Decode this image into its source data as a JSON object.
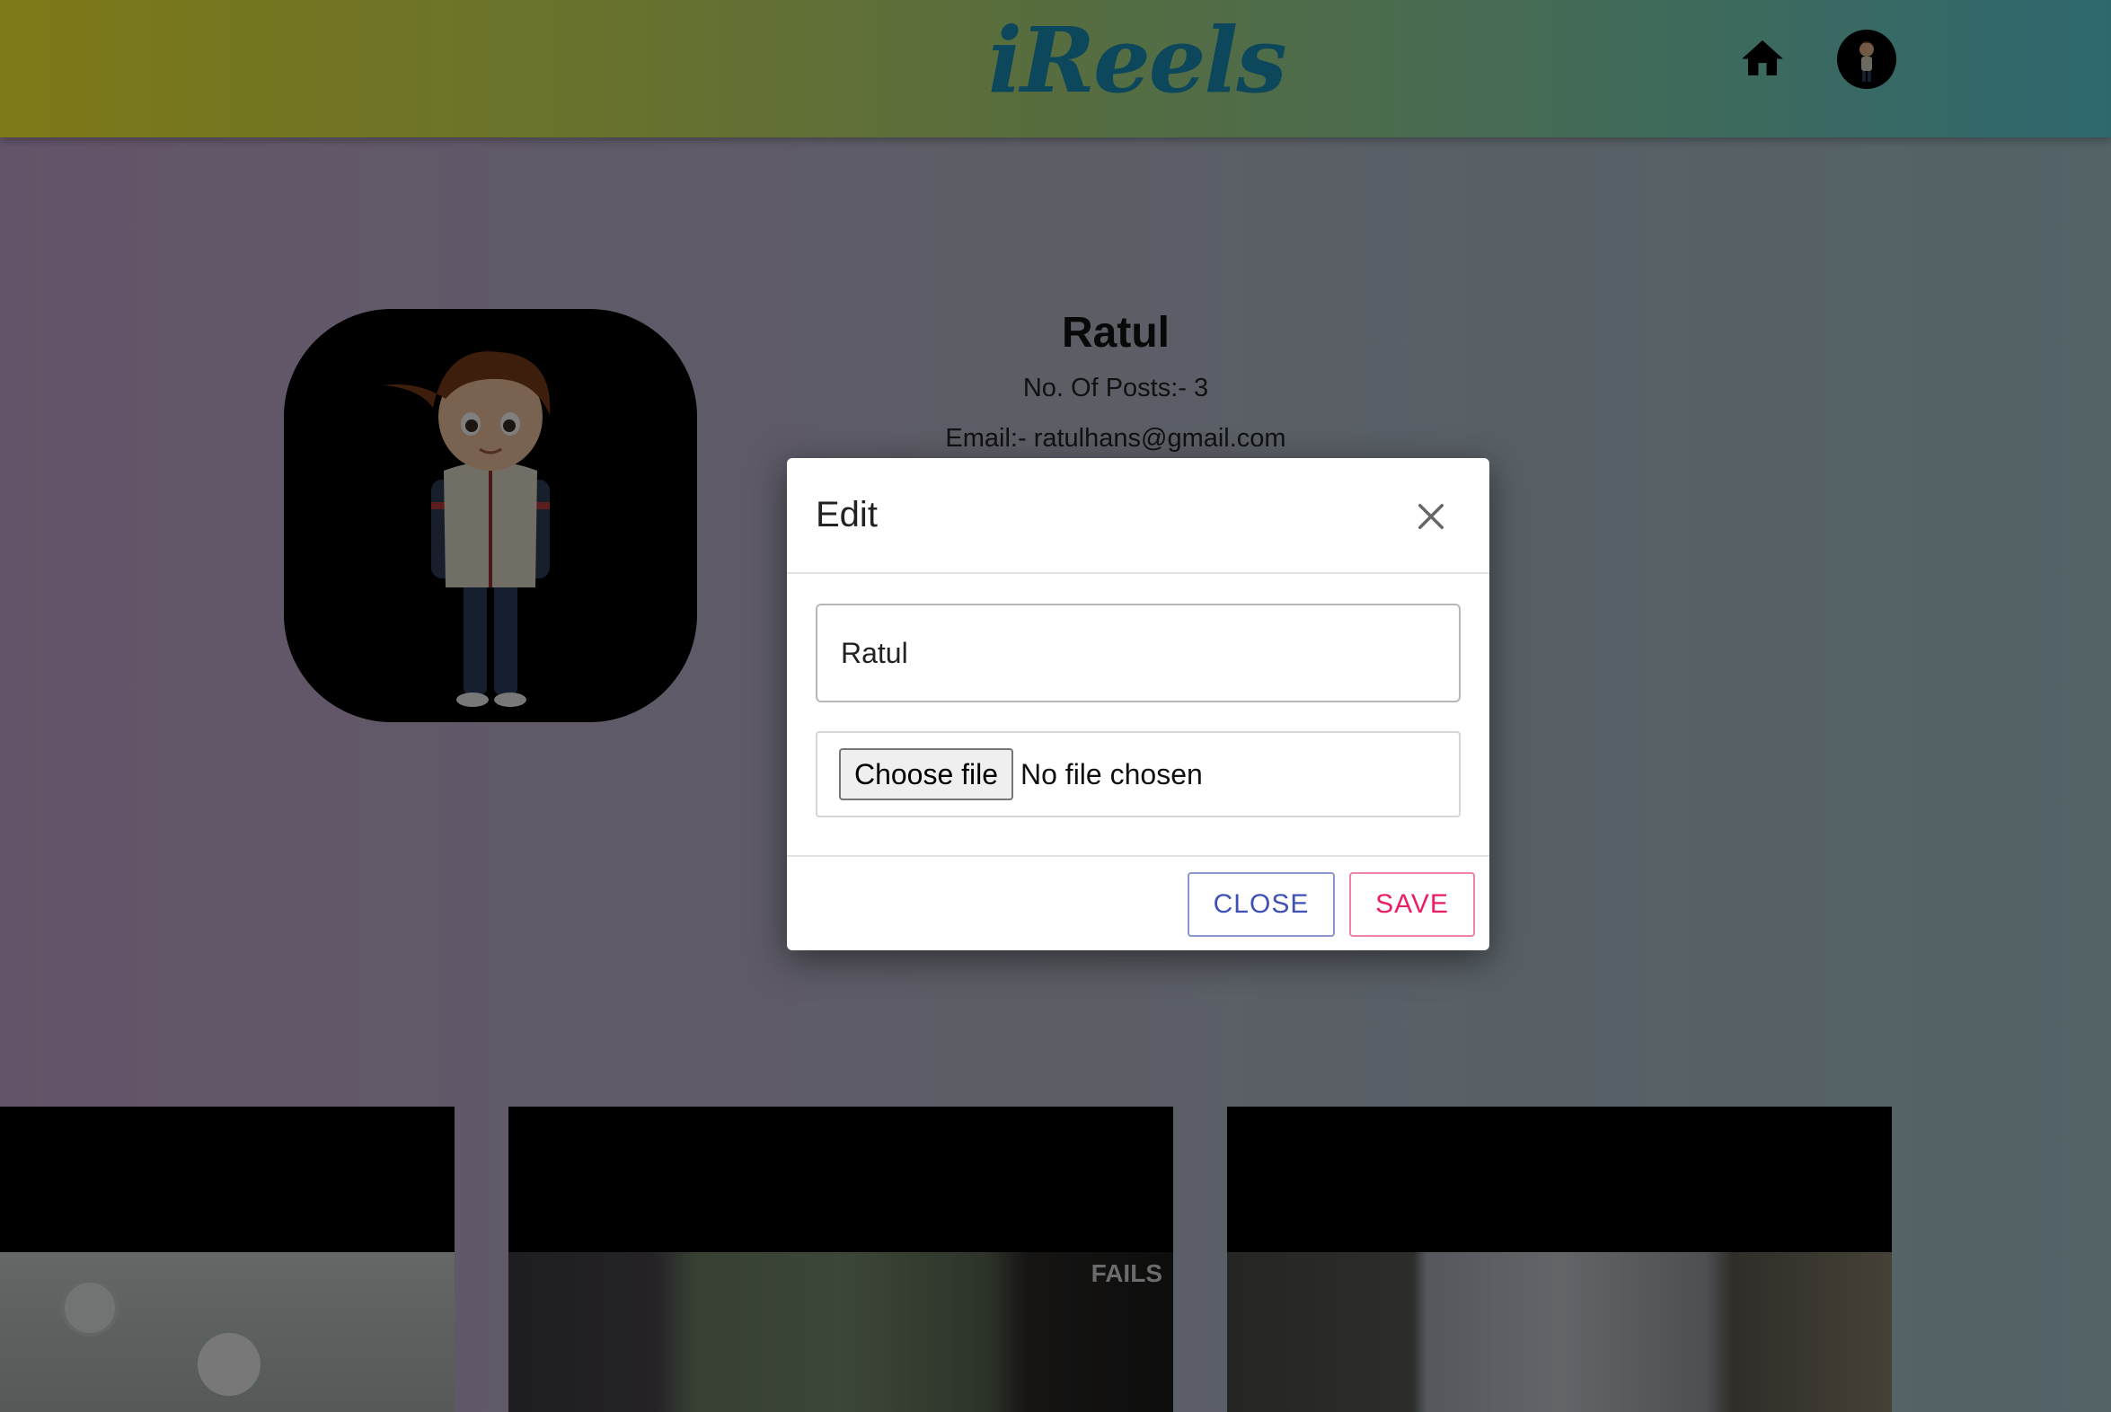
{
  "header": {
    "logo_text": "iReels",
    "home_icon": "home-icon",
    "avatar_icon": "user-avatar"
  },
  "profile": {
    "name": "Ratul",
    "posts_label": "No. Of Posts:-",
    "posts_count": "3",
    "email_label": "Email:-",
    "email": "ratulhans@gmail.com"
  },
  "reels": {
    "items": [
      {
        "overlay_text": ""
      },
      {
        "overlay_text": "FAILS"
      },
      {
        "overlay_text": ""
      }
    ]
  },
  "modal": {
    "title": "Edit",
    "close_icon": "close-icon",
    "name_value": "Ratul",
    "choose_file_label": "Choose file",
    "no_file_text": "No file chosen",
    "close_button": "CLOSE",
    "save_button": "SAVE"
  },
  "colors": {
    "close_button": "#3f51b5",
    "save_button": "#e91e63",
    "logo": "#1a8fb8"
  }
}
